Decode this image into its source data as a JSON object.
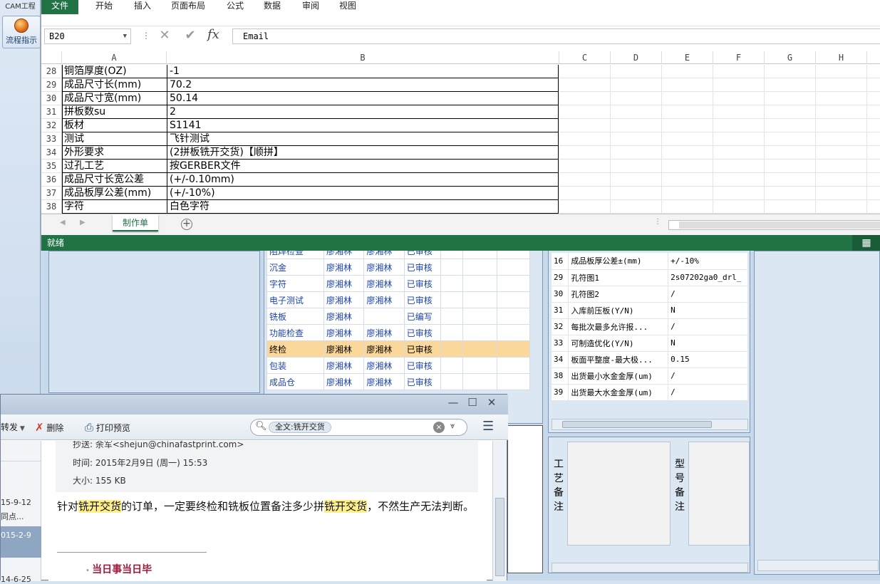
{
  "cam": {
    "title": "CAM工程",
    "flow_button": "流程指示",
    "process_rows": [
      {
        "name": "阻焊检查",
        "op1": "廖湘林",
        "op2": "廖湘林",
        "status": "已审核"
      },
      {
        "name": "沉金",
        "op1": "廖湘林",
        "op2": "廖湘林",
        "status": "已审核"
      },
      {
        "name": "字符",
        "op1": "廖湘林",
        "op2": "廖湘林",
        "status": "已审核"
      },
      {
        "name": "电子测试",
        "op1": "廖湘林",
        "op2": "廖湘林",
        "status": "已审核"
      },
      {
        "name": "铣板",
        "op1": "廖湘林",
        "op2": "",
        "status": "已编写"
      },
      {
        "name": "功能检查",
        "op1": "廖湘林",
        "op2": "廖湘林",
        "status": "已审核"
      },
      {
        "name": "终检",
        "op1": "廖湘林",
        "op2": "廖湘林",
        "status": "已审核",
        "selected": true
      },
      {
        "name": "包装",
        "op1": "廖湘林",
        "op2": "廖湘林",
        "status": "已审核"
      },
      {
        "name": "成品仓",
        "op1": "廖湘林",
        "op2": "廖湘林",
        "status": "已审核"
      }
    ],
    "params": [
      {
        "no": "16",
        "name": "成品板厚公差±(mm)",
        "value": "+/-10%"
      },
      {
        "no": "29",
        "name": "孔符图1",
        "value": "2s07202ga0_drl_"
      },
      {
        "no": "30",
        "name": "孔符图2",
        "value": "/"
      },
      {
        "no": "31",
        "name": "入库前压板(Y/N)",
        "value": "N"
      },
      {
        "no": "32",
        "name": "每批次最多允许报...",
        "value": "/"
      },
      {
        "no": "33",
        "name": "可制造优化(Y/N)",
        "value": "N"
      },
      {
        "no": "34",
        "name": "板面平整度-最大极...",
        "value": "0.15"
      },
      {
        "no": "38",
        "name": "出货最小水金金厚(um)",
        "value": "/"
      },
      {
        "no": "39",
        "name": "出货最大水金金厚(um)",
        "value": "/"
      }
    ],
    "remark_craft": "工艺备注",
    "remark_model": "型号备注"
  },
  "excel": {
    "tabs": [
      "文件",
      "开始",
      "插入",
      "页面布局",
      "公式",
      "数据",
      "审阅",
      "视图"
    ],
    "name_box": "B20",
    "formula": "Email",
    "columns": [
      "A",
      "B",
      "C",
      "D",
      "E",
      "F",
      "G",
      "H"
    ],
    "rows": [
      {
        "n": "28",
        "a": "铜箔厚度(OZ)",
        "b": "-1"
      },
      {
        "n": "29",
        "a": "成品尺寸长(mm)",
        "b": "70.2"
      },
      {
        "n": "30",
        "a": "成品尺寸宽(mm)",
        "b": "50.14"
      },
      {
        "n": "31",
        "a": "拼板数su",
        "b": "2"
      },
      {
        "n": "32",
        "a": "板材",
        "b": "S1141"
      },
      {
        "n": "33",
        "a": "测试",
        "b": "飞针测试"
      },
      {
        "n": "34",
        "a": "外形要求",
        "b": "(2拼板铣开交货)【顺拼】"
      },
      {
        "n": "35",
        "a": "过孔工艺",
        "b": "按GERBER文件"
      },
      {
        "n": "36",
        "a": "成品尺寸长宽公差",
        "b": "(+/-0.10mm)"
      },
      {
        "n": "37",
        "a": "成品板厚公差(mm)",
        "b": "(+/-10%)"
      },
      {
        "n": "38",
        "a": "字符",
        "b": "白色字符"
      }
    ],
    "sheet_tab": "制作单",
    "status": "就绪"
  },
  "mail": {
    "toolbar": {
      "forward": "转发",
      "delete": "删除",
      "print_preview": "打印预览"
    },
    "search_chip": "全文:铣开交货",
    "list": [
      {
        "date": "15-9-12",
        "snippet": "同点..."
      },
      {
        "date": "015-2-9",
        "snippet": ""
      },
      {
        "date": "14-6-25",
        "snippet": ""
      }
    ],
    "cc": "抄送: 余军<shejun@chinafastprint.com>",
    "time": "时间: 2015年2月9日 (周一) 15:53",
    "size": "大小: 155 KB",
    "body_pre": "针对",
    "hl1": "铣开交货",
    "body_mid": "的订单，一定要终检和铣板位置备注多少拼",
    "hl2": "铣开交货",
    "body_post": "，不然生产无法判断。",
    "bullet": "当日事当日毕"
  }
}
